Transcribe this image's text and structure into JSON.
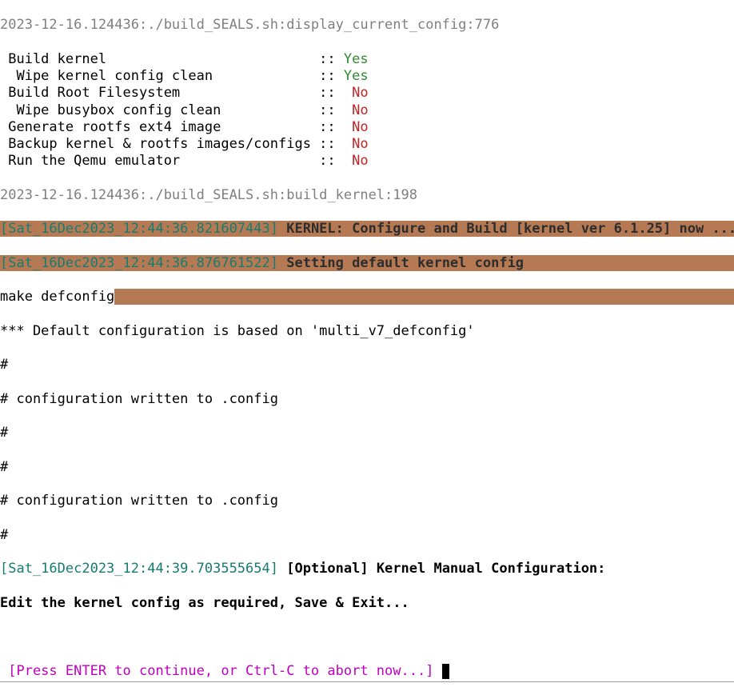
{
  "header1": "2023-12-16.124436:./build_SEALS.sh:display_current_config:776",
  "config_items": [
    {
      "label": " Build kernel                          ",
      "sep": ":: ",
      "value": "Yes",
      "color": "green"
    },
    {
      "label": "  Wipe kernel config clean             ",
      "sep": ":: ",
      "value": "Yes",
      "color": "green"
    },
    {
      "label": " Build Root Filesystem                 ",
      "sep": "::  ",
      "value": "No",
      "color": "red"
    },
    {
      "label": "  Wipe busybox config clean            ",
      "sep": "::  ",
      "value": "No",
      "color": "red"
    },
    {
      "label": " Generate rootfs ext4 image            ",
      "sep": "::  ",
      "value": "No",
      "color": "red"
    },
    {
      "label": " Backup kernel & rootfs images/configs ",
      "sep": "::  ",
      "value": "No",
      "color": "red"
    },
    {
      "label": " Run the Qemu emulator                 ",
      "sep": "::  ",
      "value": "No",
      "color": "red"
    }
  ],
  "header2": "2023-12-16.124436:./build_SEALS.sh:build_kernel:198",
  "ts1": "[Sat_16Dec2023_12:44:36.821607443] ",
  "msg1": "KERNEL: Configure and Build [kernel ver 6.1.25] now ...",
  "ts2": "[Sat_16Dec2023_12:44:36.876761522] ",
  "msg2": "Setting default kernel config",
  "make_cmd": "make defconfig",
  "defconf_msg": "*** Default configuration is based on 'multi_v7_defconfig'",
  "hash": "#",
  "conf_written": "# configuration written to .config",
  "ts3": "[Sat_16Dec2023_12:44:39.703555654] ",
  "opt_msg_pre": "[Optional] Kernel Manual Configuration:",
  "opt_msg_2": "Edit the kernel config as required, Save & Exit...",
  "prompt": " [Press ENTER to continue, or Ctrl-C to abort now...] "
}
